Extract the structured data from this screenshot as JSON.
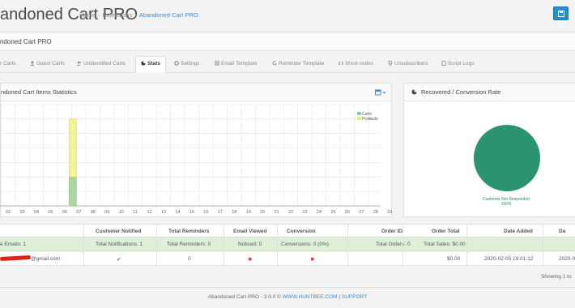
{
  "header": {
    "title": "andoned Cart PRO",
    "breadcrumb": [
      "Home",
      "Extensions",
      "Abandoned Cart PRO"
    ],
    "sep": "›"
  },
  "panel": {
    "title": "ndoned Cart PRO"
  },
  "tabs": [
    {
      "label": "r Carts",
      "icon": "user-icon",
      "active": false
    },
    {
      "label": "Guest Carts",
      "icon": "user-icon",
      "active": false
    },
    {
      "label": "Unidentified Carts",
      "icon": "users-icon",
      "active": false
    },
    {
      "label": "Stats",
      "icon": "pie-chart-icon",
      "active": true
    },
    {
      "label": "Settings",
      "icon": "gears-icon",
      "active": false
    },
    {
      "label": "Email Template",
      "icon": "list-icon",
      "active": false
    },
    {
      "label": "Reminder Template",
      "icon": "refresh-icon",
      "active": false
    },
    {
      "label": "Short-codes",
      "icon": "code-icon",
      "active": false
    },
    {
      "label": "Unsubscribers",
      "icon": "thumbs-down-icon",
      "active": false
    },
    {
      "label": "Script Logs",
      "icon": "file-icon",
      "active": false
    }
  ],
  "stats_box": {
    "title": "ndoned Cart Items Statistics"
  },
  "rate_box": {
    "title": "Recovered / Conversion Rate"
  },
  "chart_data": [
    {
      "type": "bar",
      "title": "",
      "categories": [
        "02",
        "03",
        "04",
        "05",
        "06",
        "07",
        "08",
        "09",
        "10",
        "11",
        "12",
        "13",
        "14",
        "15",
        "16",
        "17",
        "18",
        "19",
        "20",
        "21",
        "22",
        "23",
        "24",
        "25",
        "26",
        "27",
        "28",
        "29"
      ],
      "series": [
        {
          "name": "Carts",
          "color": "#a8d8a0",
          "values": [
            0,
            0,
            0,
            1,
            0,
            0,
            0,
            0,
            0,
            0,
            0,
            0,
            0,
            0,
            0,
            0,
            0,
            0,
            0,
            0,
            0,
            0,
            0,
            0,
            0,
            0,
            0,
            0
          ]
        },
        {
          "name": "Products",
          "color": "#f3f19a",
          "values": [
            0,
            0,
            0,
            2,
            0,
            0,
            0,
            0,
            0,
            0,
            0,
            0,
            0,
            0,
            0,
            0,
            0,
            0,
            0,
            0,
            0,
            0,
            0,
            0,
            0,
            0,
            0,
            0
          ]
        }
      ],
      "stacked": true,
      "ylim": [
        0,
        3.5
      ],
      "grid": true,
      "legend": "top-right"
    },
    {
      "type": "pie",
      "title": "",
      "slices": [
        {
          "label": "Customer Not Responded",
          "value": 100,
          "percent": "100%",
          "color": "#2a9372"
        }
      ]
    }
  ],
  "table": {
    "headers": [
      "",
      "Customer Notified",
      "Total Reminders",
      "Email Viewed",
      "Conversion",
      "Order ID",
      "Order Total",
      "Date Added",
      "Da"
    ],
    "summary": [
      "e Emails: 1",
      "Total Notifications: 1",
      "Total Reminders: 0",
      "Noticed: 0",
      "Conversions: 0 (0%)",
      "Total Orders: 0",
      "Total Sales: $0.00",
      "",
      ""
    ],
    "rows": [
      [
        "@gmail.com",
        "✔",
        "0",
        "✖",
        "✖",
        "",
        "$0.00",
        "2020-02-05 19:01:12",
        "2020-0"
      ]
    ],
    "showing": "Showing 1 to"
  },
  "footer": {
    "prefix": "Abandoned Cart PRO - 3.0.0 ©",
    "link1": "WWW.HUNTBEE.COM",
    "sep": " | ",
    "link2": "SUPPORT"
  },
  "colors": {
    "accent": "#1e91cf",
    "success_row": "#dff0d8",
    "pie": "#2a9372",
    "check": "#3c9a3c",
    "cross": "#d9261c"
  }
}
